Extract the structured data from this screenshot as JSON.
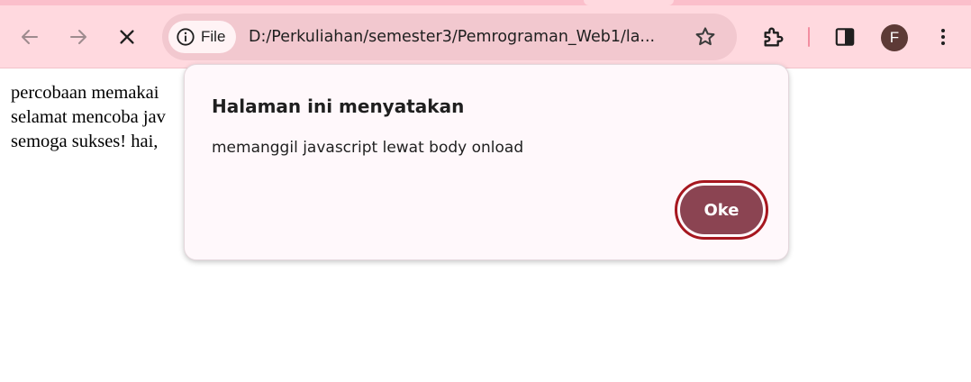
{
  "toolbar": {
    "site_chip_label": "File",
    "url": "D:/Perkuliahan/semester3/Pemrograman_Web1/la...",
    "profile_initial": "F"
  },
  "page": {
    "lines": [
      "percobaan memakai",
      "selamat mencoba jav",
      "semoga sukses! hai,"
    ]
  },
  "dialog": {
    "title": "Halaman ini menyatakan",
    "message": "memanggil javascript lewat body onload",
    "ok_label": "Oke"
  },
  "colors": {
    "toolbar_bg": "#ffd9df",
    "omnibox_bg": "#f2c8cf",
    "ok_button": "#8b4452",
    "ok_focus_ring": "#a6171f"
  },
  "icons": {
    "back": "arrow-left",
    "forward": "arrow-right",
    "stop": "close-x",
    "site_info": "info-circle",
    "bookmark": "star-outline",
    "extensions": "puzzle-piece",
    "side_panel": "side-panel",
    "menu": "three-dots-vertical"
  }
}
